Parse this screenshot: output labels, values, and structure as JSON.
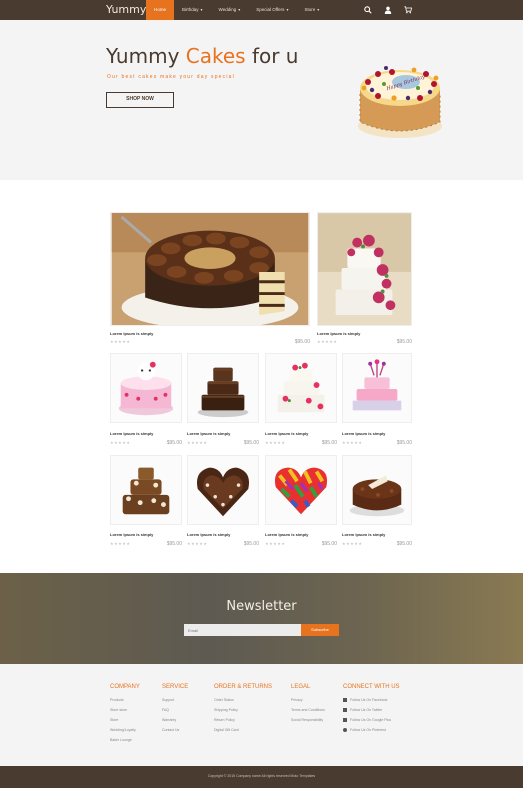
{
  "nav": {
    "brand": "Yummy",
    "items": [
      {
        "label": "Home",
        "active": true,
        "caret": ""
      },
      {
        "label": "Birthday",
        "active": false,
        "caret": "▾"
      },
      {
        "label": "Wedding",
        "active": false,
        "caret": "▾"
      },
      {
        "label": "Special Offers",
        "active": false,
        "caret": "▾"
      },
      {
        "label": "Store",
        "active": false,
        "caret": "▾"
      }
    ],
    "icons": [
      "search-icon",
      "user-icon",
      "cart-icon"
    ]
  },
  "hero": {
    "title_part1": "Yummy ",
    "title_accent": "Cakes",
    "title_part2": " for u",
    "subtitle": "Our best cakes make your day special",
    "button": "SHOP NOW",
    "cake_text": "Happy Birthday"
  },
  "products": [
    {
      "title": "Lorem Ipsum is simply",
      "stars": "★★★★★",
      "price": "$95.00"
    },
    {
      "title": "Lorem Ipsum is simply",
      "stars": "★★★★★",
      "price": "$95.00"
    },
    {
      "title": "Lorem Ipsum is simply",
      "stars": "★★★★★",
      "price": "$95.00"
    },
    {
      "title": "Lorem Ipsum is simply",
      "stars": "★★★★★",
      "price": "$95.00"
    },
    {
      "title": "Lorem Ipsum is simply",
      "stars": "★★★★★",
      "price": "$95.00"
    },
    {
      "title": "Lorem Ipsum is simply",
      "stars": "★★★★★",
      "price": "$95.00"
    },
    {
      "title": "Lorem Ipsum is simply",
      "stars": "★★★★★",
      "price": "$95.00"
    },
    {
      "title": "Lorem Ipsum is simply",
      "stars": "★★★★★",
      "price": "$95.00"
    },
    {
      "title": "Lorem Ipsum is simply",
      "stars": "★★★★★",
      "price": "$95.00"
    },
    {
      "title": "Lorem Ipsum is simply",
      "stars": "★★★★★",
      "price": "$95.00"
    }
  ],
  "newsletter": {
    "title": "Newsletter",
    "placeholder": "Email",
    "button": "Subscribe"
  },
  "footer": {
    "company": {
      "heading": "COMPANY",
      "links": [
        "Products",
        "Store store",
        "Store",
        "Wedding/Loyalty",
        "Baker Lounge"
      ]
    },
    "service": {
      "heading": "SERVICE",
      "links": [
        "Support",
        "FAQ",
        "Warranty",
        "Contact Us"
      ]
    },
    "orders": {
      "heading": "ORDER & RETURNS",
      "links": [
        "Order Status",
        "Shipping Policy",
        "Return Policy",
        "Digital Gift Card"
      ]
    },
    "legal": {
      "heading": "LEGAL",
      "links": [
        "Privacy",
        "Terms and Conditions",
        "Social Responsibility"
      ]
    },
    "connect": {
      "heading": "CONNECT WITH US",
      "links": [
        "Follow Us On Facebook",
        "Follow Us On Twitter",
        "Follow Us On Google Plus",
        "Follow Us On Pinterest"
      ]
    },
    "copyright": "Copyright © 2015 Company name All rights reserved Moto Templates",
    "colors": {
      "accent": "#e8731f",
      "dark": "#4a3b30"
    }
  }
}
